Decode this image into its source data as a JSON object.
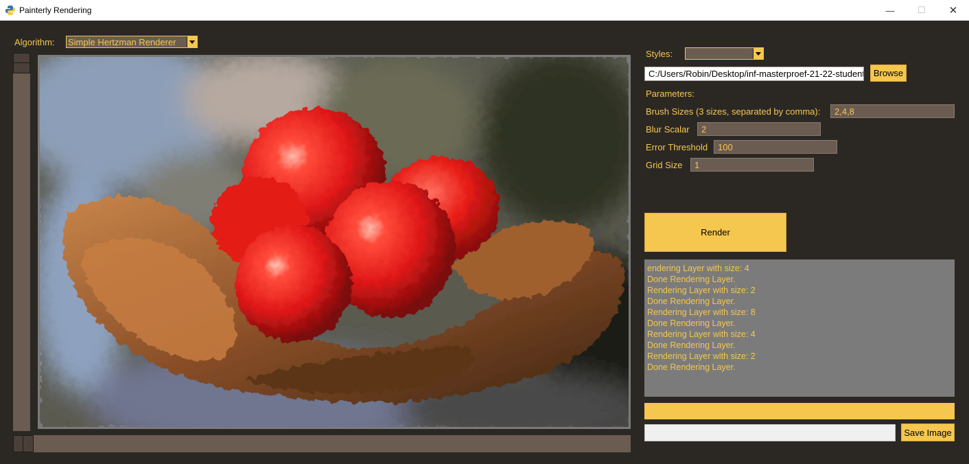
{
  "window": {
    "title": "Painterly Rendering",
    "controls": {
      "minimize": "—",
      "maximize": "☐",
      "close": "✕"
    }
  },
  "algorithm": {
    "label": "Algorithm:",
    "selected": "Simple Hertzman Renderer"
  },
  "styles": {
    "label": "Styles:",
    "selected": ""
  },
  "file": {
    "path": "C:/Users/Robin/Desktop/inf-masterproef-21-22-student-",
    "browse_label": "Browse"
  },
  "parameters": {
    "heading": "Parameters:",
    "brush_sizes": {
      "label": "Brush Sizes (3 sizes, separated by comma):",
      "value": "2,4,8"
    },
    "blur_scalar": {
      "label": "Blur Scalar",
      "value": "2"
    },
    "error_threshold": {
      "label": "Error Threshold",
      "value": "100"
    },
    "grid_size": {
      "label": "Grid Size",
      "value": "1"
    }
  },
  "render_label": "Render",
  "log": [
    "endering Layer with size: 4",
    "Done Rendering Layer.",
    "Rendering Layer with size: 2",
    "Done Rendering Layer.",
    "Rendering Layer with size: 8",
    "Done Rendering Layer.",
    "Rendering Layer with size: 4",
    "Done Rendering Layer.",
    "Rendering Layer with size: 2",
    "Done Rendering Layer."
  ],
  "progress": 1.0,
  "save": {
    "path": "",
    "button_label": "Save Image"
  },
  "colors": {
    "accent": "#f5c74f",
    "background": "#2b2824",
    "field": "#6b5c52",
    "log_bg": "#7b7b7b"
  }
}
